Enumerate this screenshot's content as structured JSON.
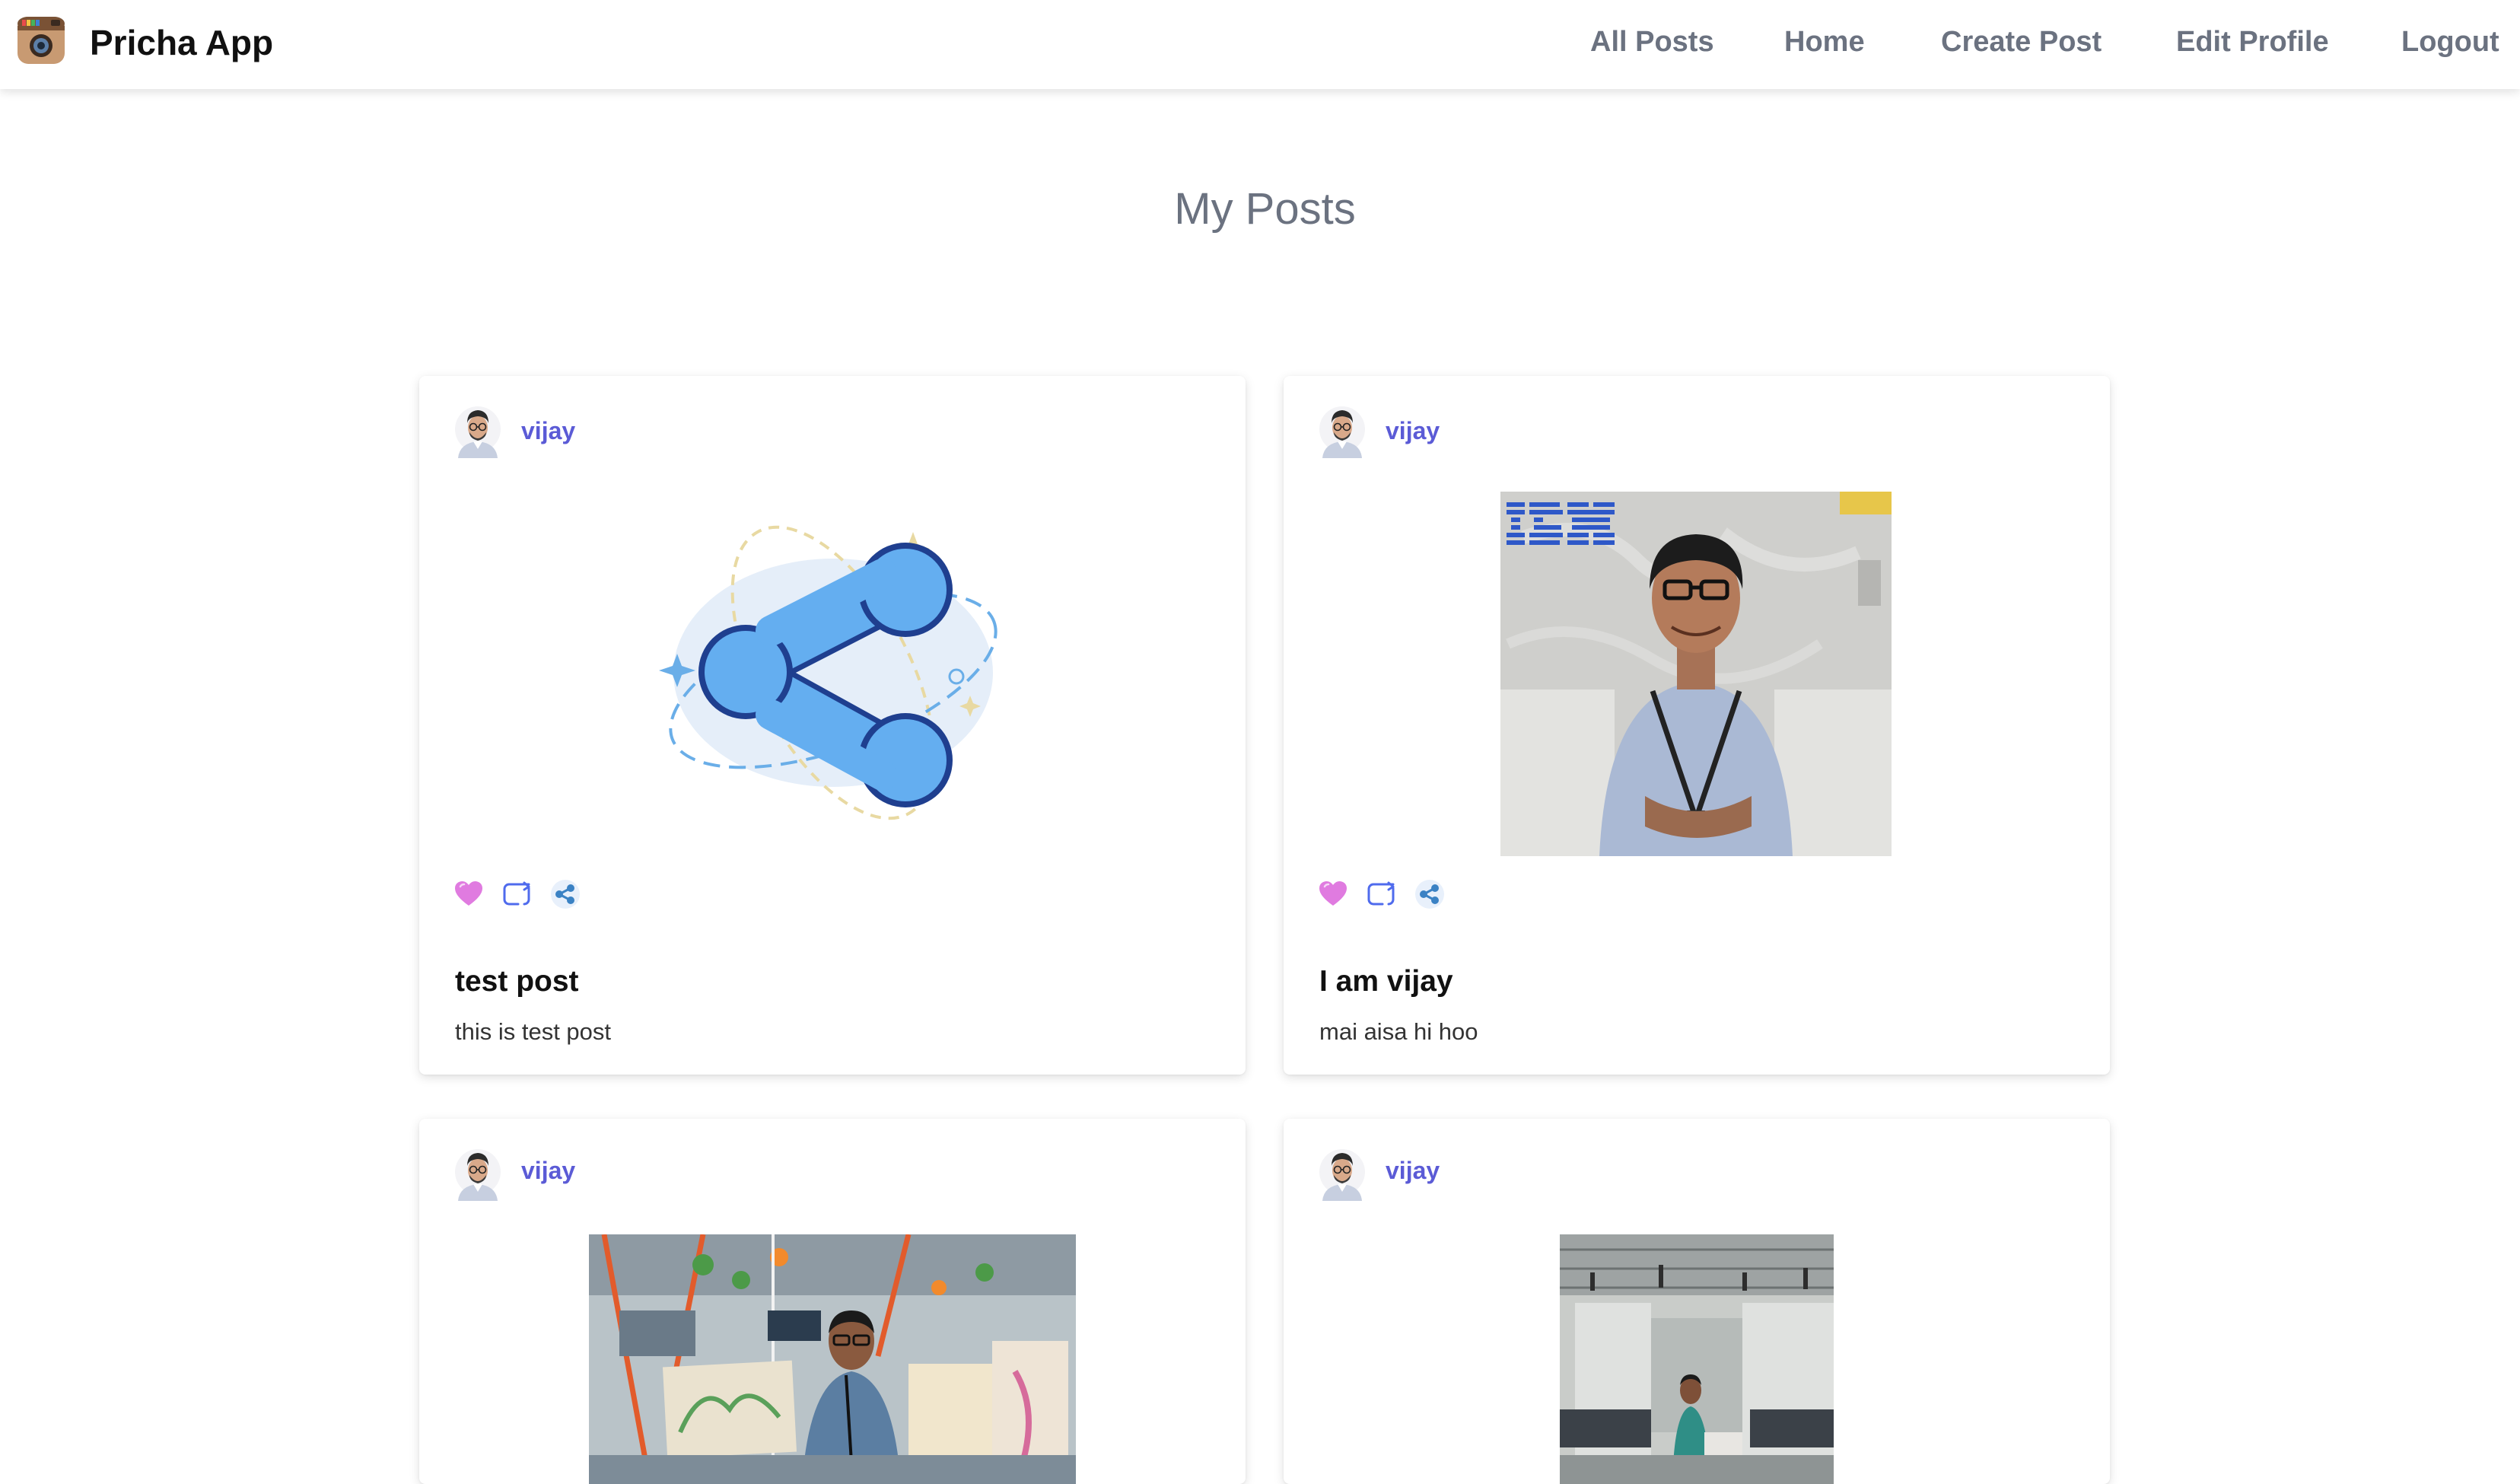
{
  "nav": {
    "brand": "Pricha App",
    "links": [
      "All Posts",
      "Home",
      "Create Post",
      "Edit Profile",
      "Logout"
    ]
  },
  "page": {
    "heading": "My Posts"
  },
  "posts": [
    {
      "author": "vijay",
      "title": "test post",
      "body": "this is test post",
      "media_icon": "share-illustration"
    },
    {
      "author": "vijay",
      "title": "I am vijay",
      "body": "mai aisa hi hoo",
      "media_icon": "photo-ibm"
    },
    {
      "author": "vijay",
      "title": "",
      "body": "",
      "media_icon": "photo-office-drawings"
    },
    {
      "author": "vijay",
      "title": "",
      "body": "",
      "media_icon": "photo-office-floor"
    }
  ],
  "colors": {
    "accent": "#5b5bd6",
    "like": "#e07be0",
    "repost": "#4f6bed",
    "share": "#3b82c4"
  }
}
